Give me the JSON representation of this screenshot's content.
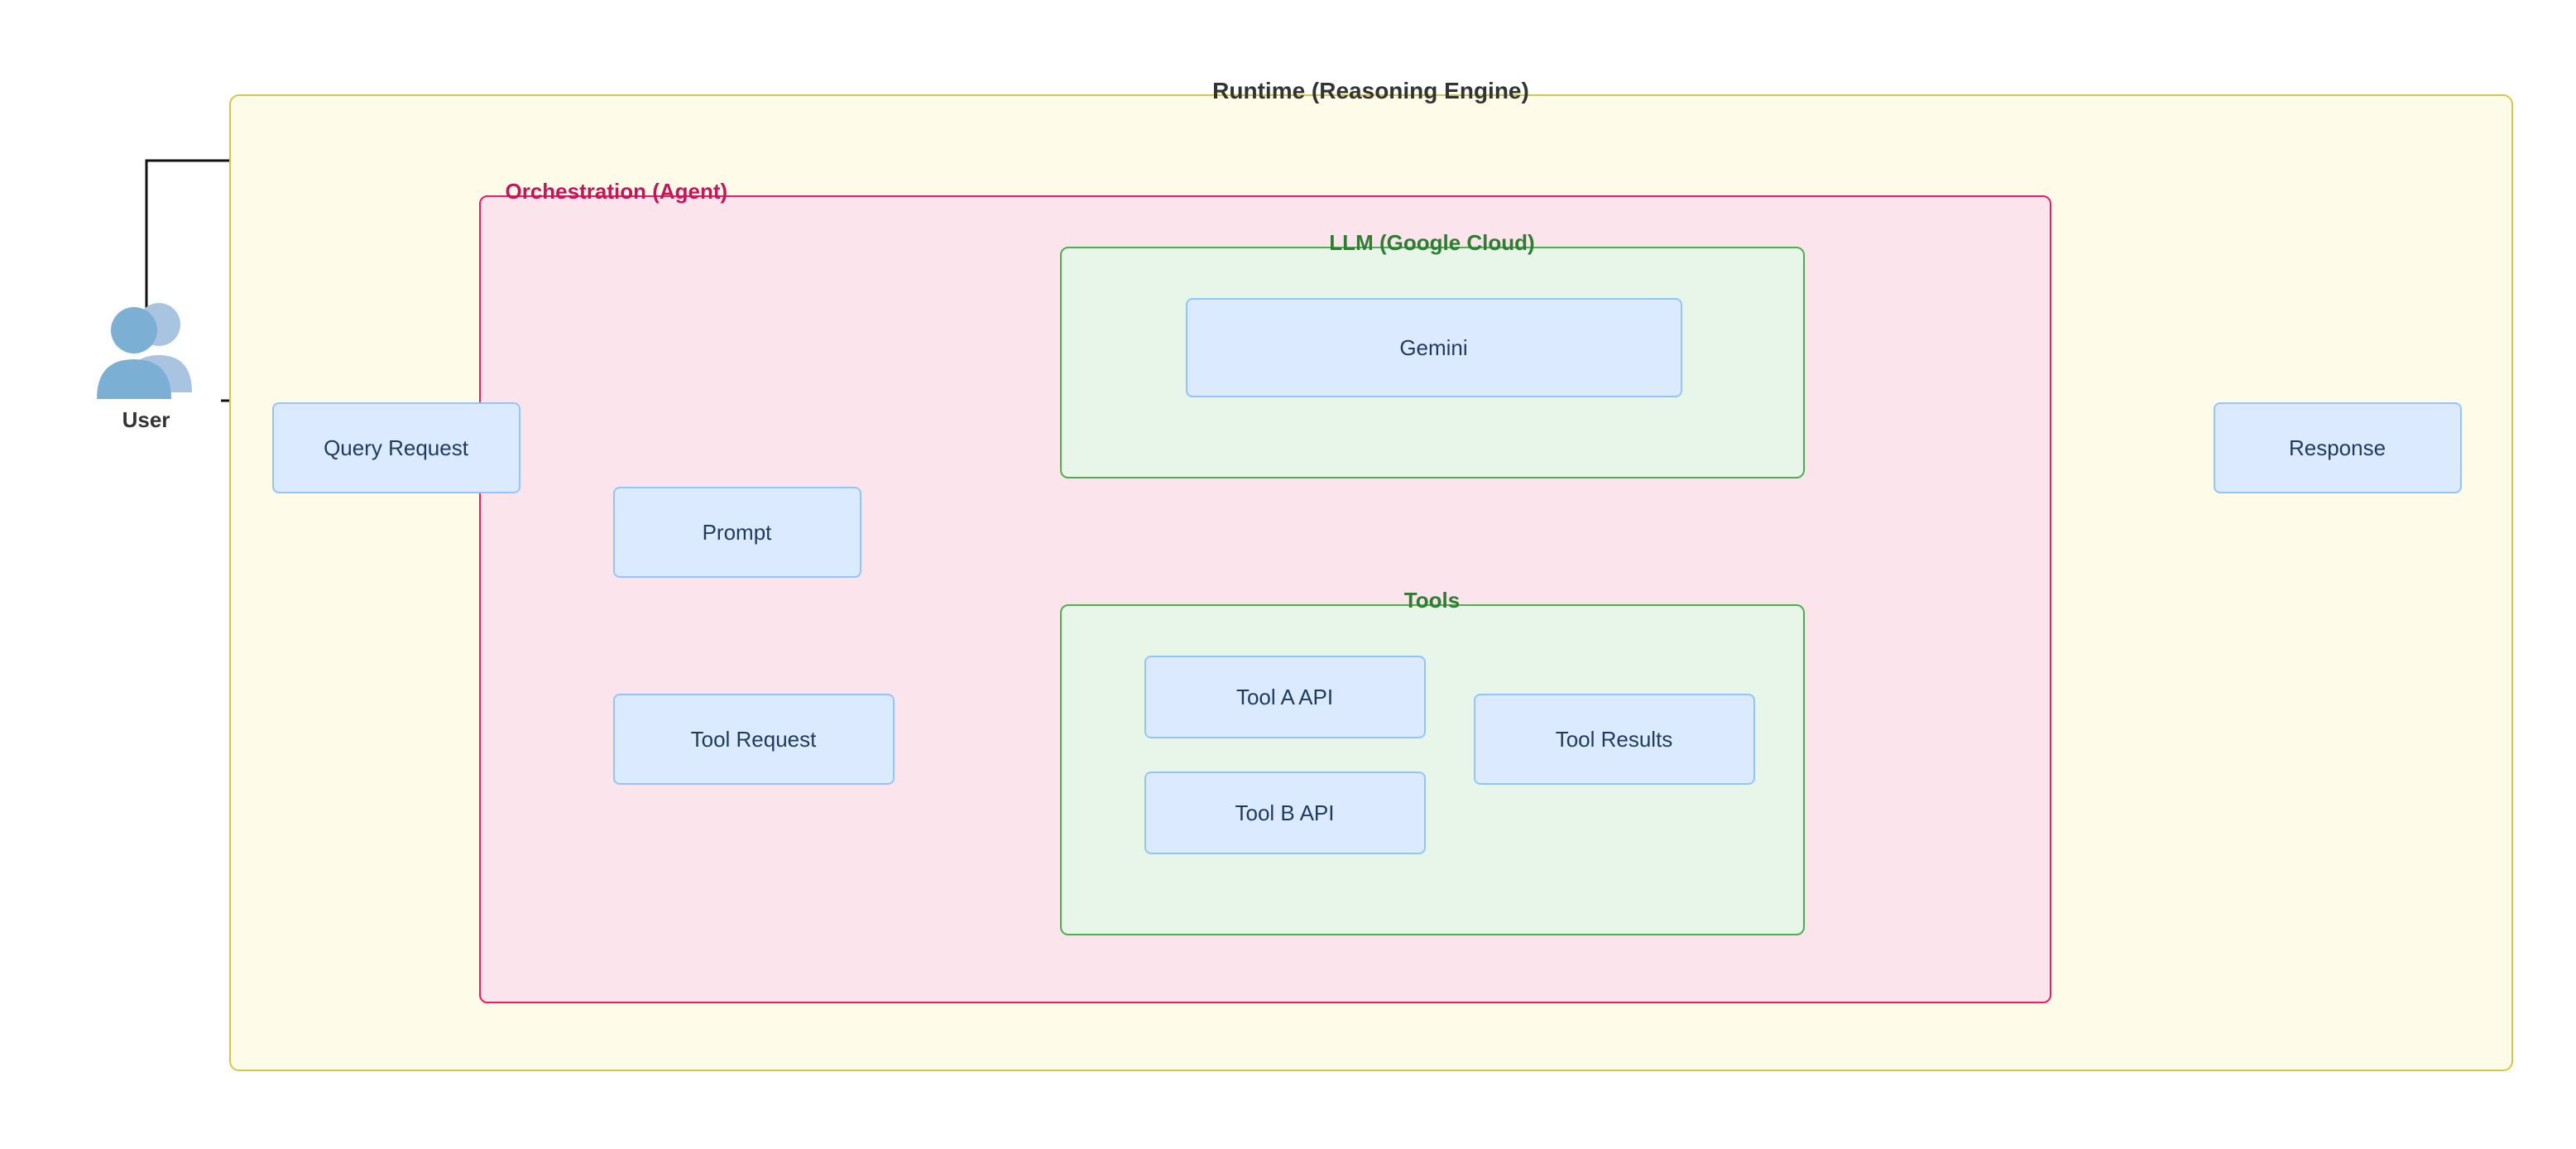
{
  "diagram": {
    "title": "Runtime (Reasoning Engine)",
    "orchestration_label": "Orchestration (Agent)",
    "llm_label": "LLM (Google Cloud)",
    "tools_label": "Tools",
    "user_label": "User",
    "nodes": {
      "query_request": "Query Request",
      "prompt": "Prompt",
      "gemini": "Gemini",
      "tool_request": "Tool Request",
      "tool_results": "Tool Results",
      "tool_a": "Tool A API",
      "tool_b": "Tool B API",
      "response": "Response"
    }
  }
}
